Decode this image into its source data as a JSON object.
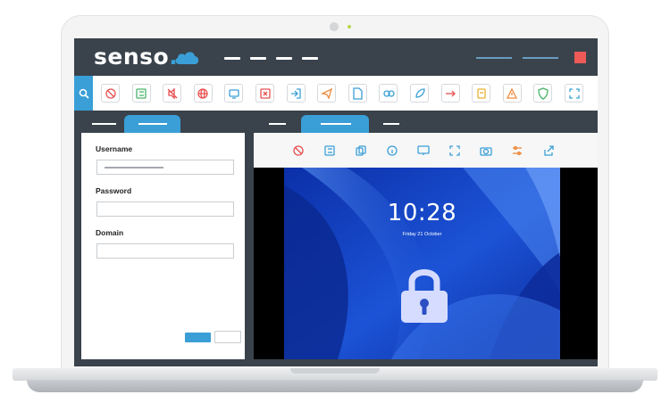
{
  "brand": {
    "name": "senso",
    "dot": ".",
    "accent_color": "#3a9fd6",
    "cloud_icon": "cloud-icon"
  },
  "header": {
    "close_color": "#ee5a57"
  },
  "toolbar": {
    "search_icon": "search-icon",
    "tools": [
      {
        "icon": "block-icon",
        "color": "#e84f4f"
      },
      {
        "icon": "checklist-icon",
        "color": "#49b36a"
      },
      {
        "icon": "mute-icon",
        "color": "#e84f4f"
      },
      {
        "icon": "globe-icon",
        "color": "#e84f4f"
      },
      {
        "icon": "screen-share-icon",
        "color": "#3a9fd6"
      },
      {
        "icon": "close-window-icon",
        "color": "#e84f4f"
      },
      {
        "icon": "login-icon",
        "color": "#3a9fd6"
      },
      {
        "icon": "send-icon",
        "color": "#f08a3c"
      },
      {
        "icon": "file-icon",
        "color": "#3a9fd6"
      },
      {
        "icon": "gamepad-icon",
        "color": "#3a9fd6"
      },
      {
        "icon": "rocket-icon",
        "color": "#3a9fd6"
      },
      {
        "icon": "usb-icon",
        "color": "#e84f4f"
      },
      {
        "icon": "document-icon",
        "color": "#e6b02e"
      },
      {
        "icon": "warning-icon",
        "color": "#f08a3c"
      },
      {
        "icon": "shield-icon",
        "color": "#49b36a"
      },
      {
        "icon": "scan-icon",
        "color": "#3a9fd6"
      }
    ]
  },
  "login": {
    "username_label": "Username",
    "password_label": "Password",
    "domain_label": "Domain"
  },
  "session": {
    "tools": [
      {
        "icon": "block-icon",
        "color": "#e84f4f"
      },
      {
        "icon": "checklist-icon",
        "color": "#3a9fd6"
      },
      {
        "icon": "copy-icon",
        "color": "#3a9fd6"
      },
      {
        "icon": "info-icon",
        "color": "#3a9fd6"
      },
      {
        "icon": "monitor-icon",
        "color": "#3a9fd6"
      },
      {
        "icon": "fullscreen-icon",
        "color": "#3a9fd6"
      },
      {
        "icon": "camera-icon",
        "color": "#3a9fd6"
      },
      {
        "icon": "settings-sliders-icon",
        "color": "#f08a3c"
      },
      {
        "icon": "share-icon",
        "color": "#3a9fd6"
      }
    ],
    "lock_time": "10:28",
    "lock_date": "Friday 21 October"
  }
}
